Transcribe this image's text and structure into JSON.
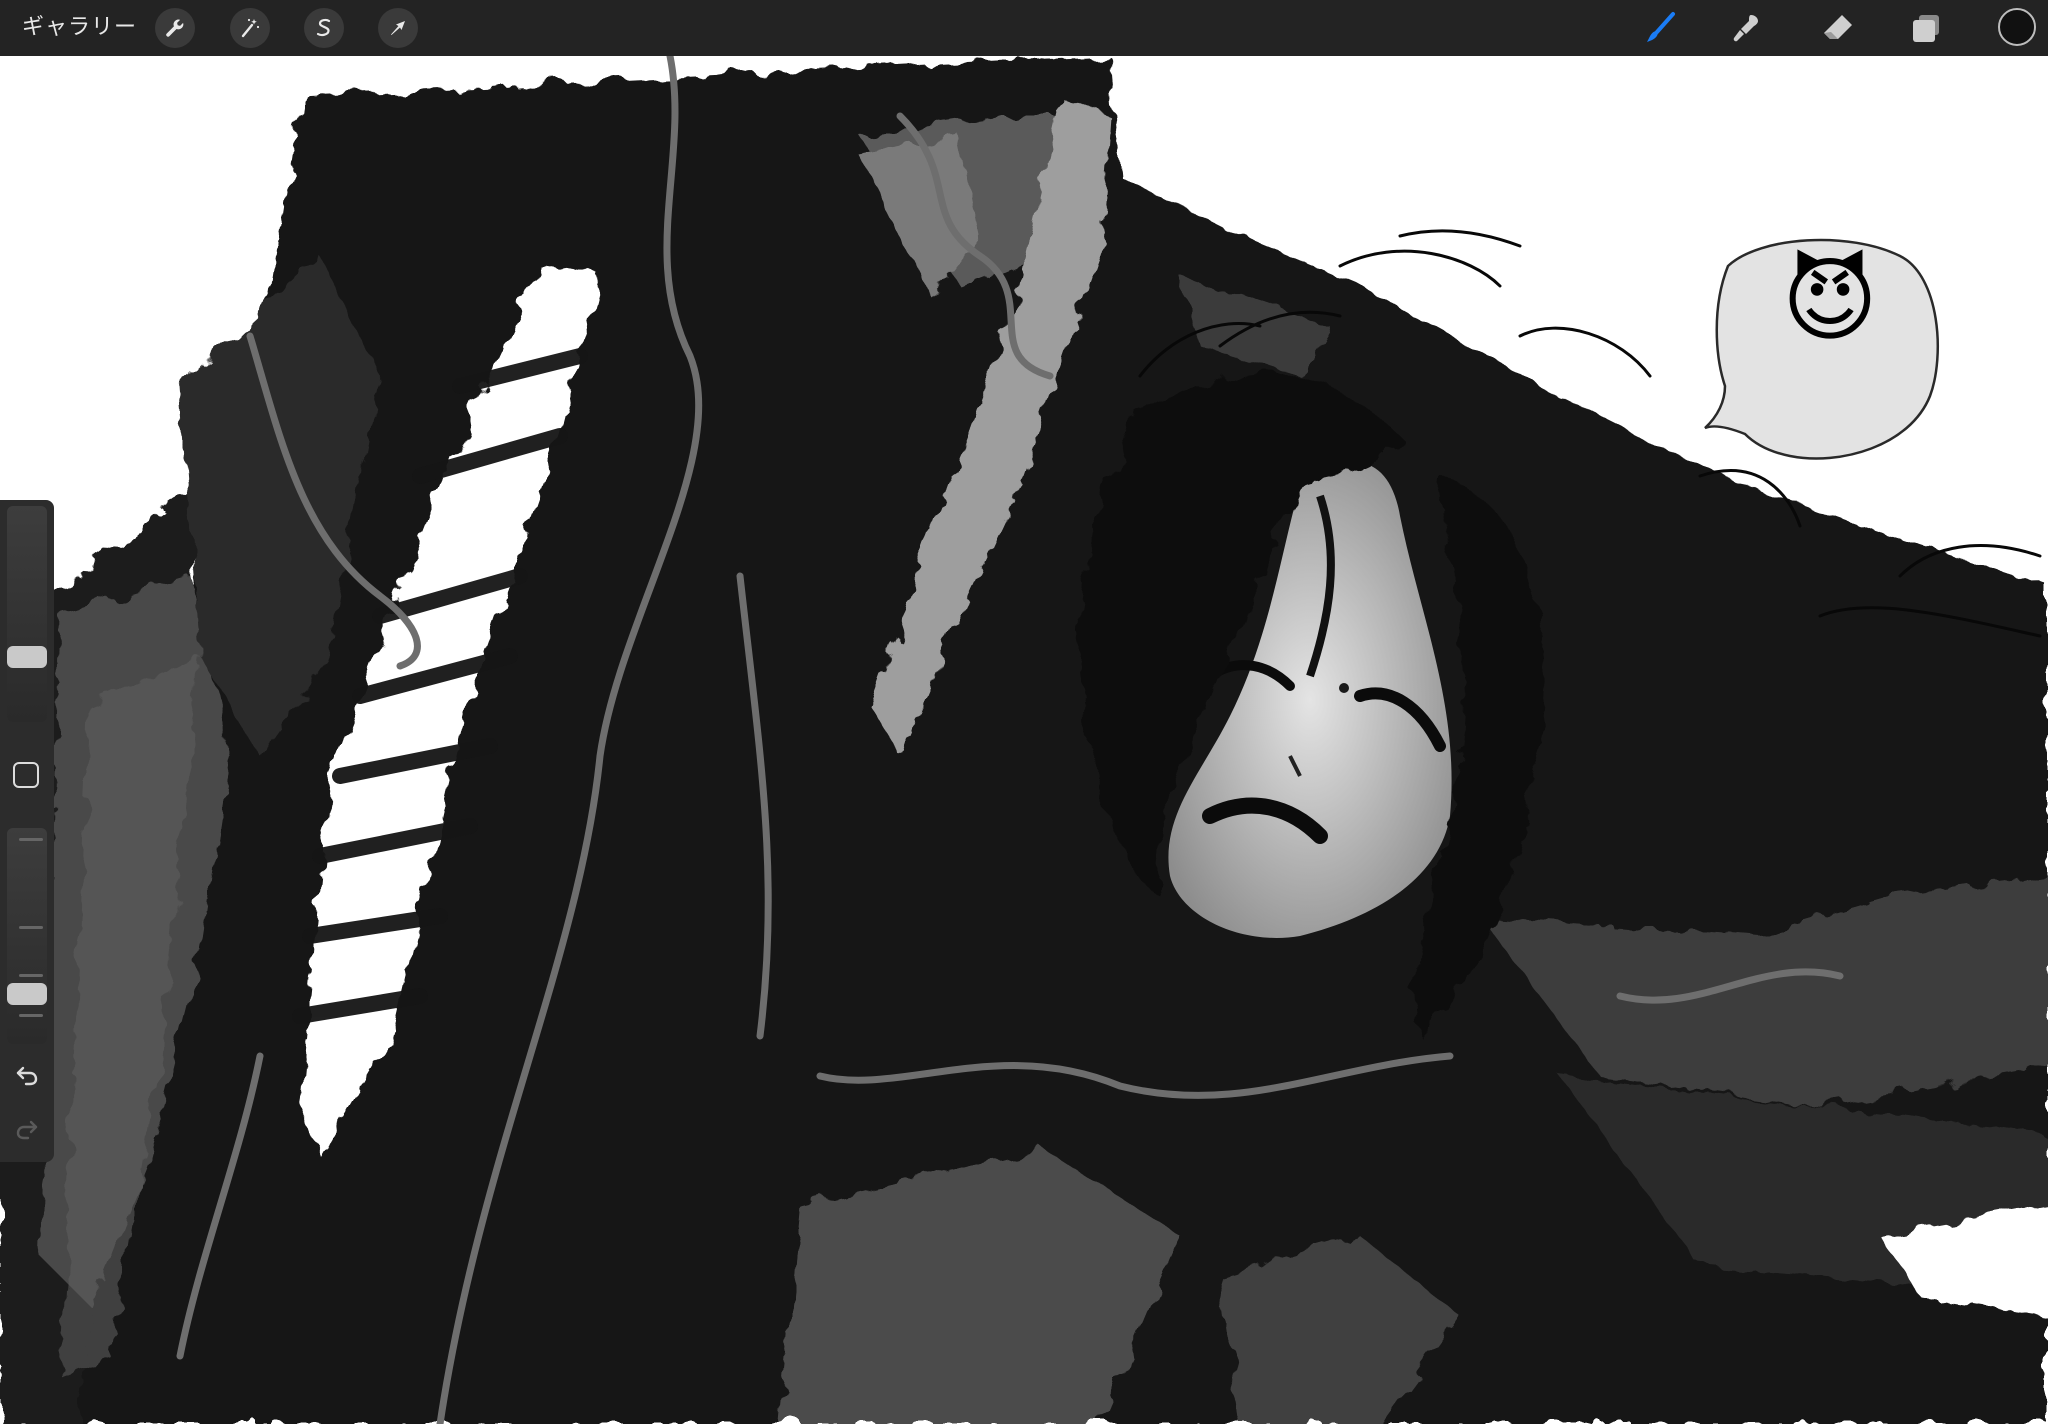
{
  "toolbar": {
    "gallery_label": "ギャラリー",
    "left_tools": [
      {
        "name": "actions",
        "icon": "wrench-icon"
      },
      {
        "name": "adjustments",
        "icon": "magic-wand-icon"
      },
      {
        "name": "selection",
        "icon": "selection-s-icon"
      },
      {
        "name": "transform",
        "icon": "arrow-cursor-icon"
      }
    ],
    "right_tools": [
      {
        "name": "brush",
        "icon": "brush-icon",
        "active": true
      },
      {
        "name": "smudge",
        "icon": "smudge-icon",
        "active": false
      },
      {
        "name": "eraser",
        "icon": "eraser-icon",
        "active": false
      },
      {
        "name": "layers",
        "icon": "layers-icon",
        "active": false
      }
    ],
    "current_color": "#111111",
    "accent_color": "#1a7cf5"
  },
  "sidebar": {
    "brush_size_level": 0.3,
    "opacity_level": 0.2,
    "undo_icon": "undo-icon",
    "redo_icon": "redo-icon",
    "modify_icon": "square-icon"
  },
  "canvas": {
    "sticker_emoji": "😈"
  }
}
